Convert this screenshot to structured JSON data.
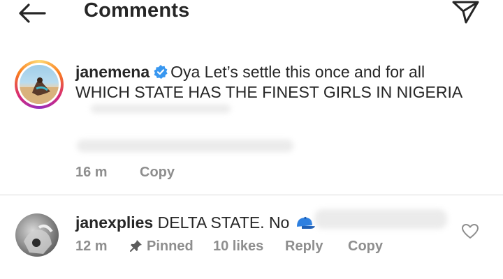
{
  "header": {
    "title": "Comments",
    "back_icon": "arrow-left-icon",
    "share_icon": "paper-plane-icon"
  },
  "post": {
    "username": "janemena",
    "verified": true,
    "caption_line1": "Oya Let’s settle this once and for all",
    "caption_line2": "WHICH STATE HAS THE FINEST GIRLS IN NIGERIA",
    "time": "16 m",
    "copy_label": "Copy"
  },
  "comment": {
    "username": "janexplies",
    "text": "DELTA STATE. No",
    "emoji_icon": "blue-cap-icon",
    "time": "12 m",
    "pinned_label": "Pinned",
    "likes": "10 likes",
    "reply_label": "Reply",
    "copy_label": "Copy",
    "like_icon": "heart-outline-icon"
  },
  "colors": {
    "text": "#262626",
    "muted": "#8e8e8e",
    "verified": "#3897f0",
    "divider": "#dbdbdb"
  }
}
